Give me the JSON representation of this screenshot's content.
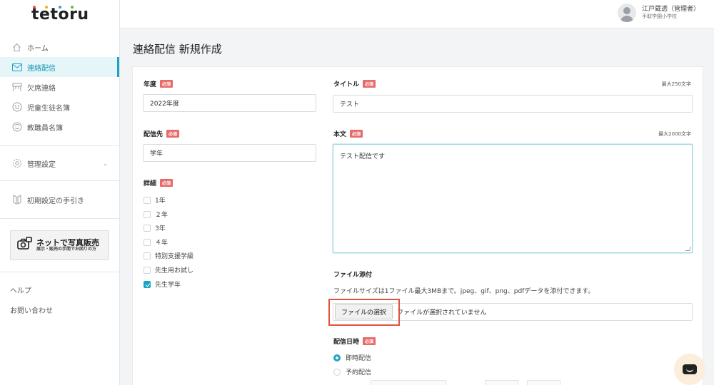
{
  "brand": {
    "logo": "tetoru",
    "dot_colors": [
      "#e94e4e",
      "#f4b400",
      "#2aa8c9",
      "#66bb3c"
    ]
  },
  "sidebar": {
    "items": [
      {
        "label": "ホーム",
        "icon": "home-icon"
      },
      {
        "label": "連絡配信",
        "icon": "mail-icon",
        "active": true
      },
      {
        "label": "欠席連絡",
        "icon": "desk-icon"
      },
      {
        "label": "児童生徒名簿",
        "icon": "face-icon"
      },
      {
        "label": "教職員名簿",
        "icon": "face-icon"
      }
    ],
    "settings_label": "管理設定",
    "guide_label": "初期設定の手引き",
    "banner_title": "ネットで写真販売",
    "banner_sub": "展示・販売の手間でお困りの方",
    "help_label": "ヘルプ",
    "contact_label": "お問い合わせ"
  },
  "header": {
    "user_name": "江戸蔵透（管理者）",
    "school": "手取学園小学校"
  },
  "page": {
    "title": "連絡配信 新規作成"
  },
  "form": {
    "required_badge": "必須",
    "year": {
      "label": "年度",
      "value": "2022年度"
    },
    "recipient": {
      "label": "配信先",
      "value": "学年"
    },
    "details": {
      "label": "詳細",
      "options": [
        {
          "label": "1年",
          "checked": false
        },
        {
          "label": "２年",
          "checked": false
        },
        {
          "label": "3年",
          "checked": false
        },
        {
          "label": "４年",
          "checked": false
        },
        {
          "label": "特別支援学級",
          "checked": false
        },
        {
          "label": "先生用お試し",
          "checked": false
        },
        {
          "label": "先生学年",
          "checked": true
        }
      ]
    },
    "title": {
      "label": "タイトル",
      "limit": "最大250文字",
      "value": "テスト"
    },
    "body": {
      "label": "本文",
      "limit": "最大2000文字",
      "value": "テスト配信です"
    },
    "attachment": {
      "label": "ファイル添付",
      "note": "ファイルサイズは1ファイル最大3MBまで。jpeg、gif、png、pdfデータを添付できます。",
      "button": "ファイルの選択",
      "status": "ファイルが選択されていません"
    },
    "schedule": {
      "label": "配信日時",
      "options": [
        {
          "label": "即時配信",
          "selected": true
        },
        {
          "label": "予約配信",
          "selected": false
        }
      ]
    }
  },
  "colors": {
    "accent": "#1aa3c4",
    "required": "#e86a6a",
    "highlight": "#e0533c"
  }
}
